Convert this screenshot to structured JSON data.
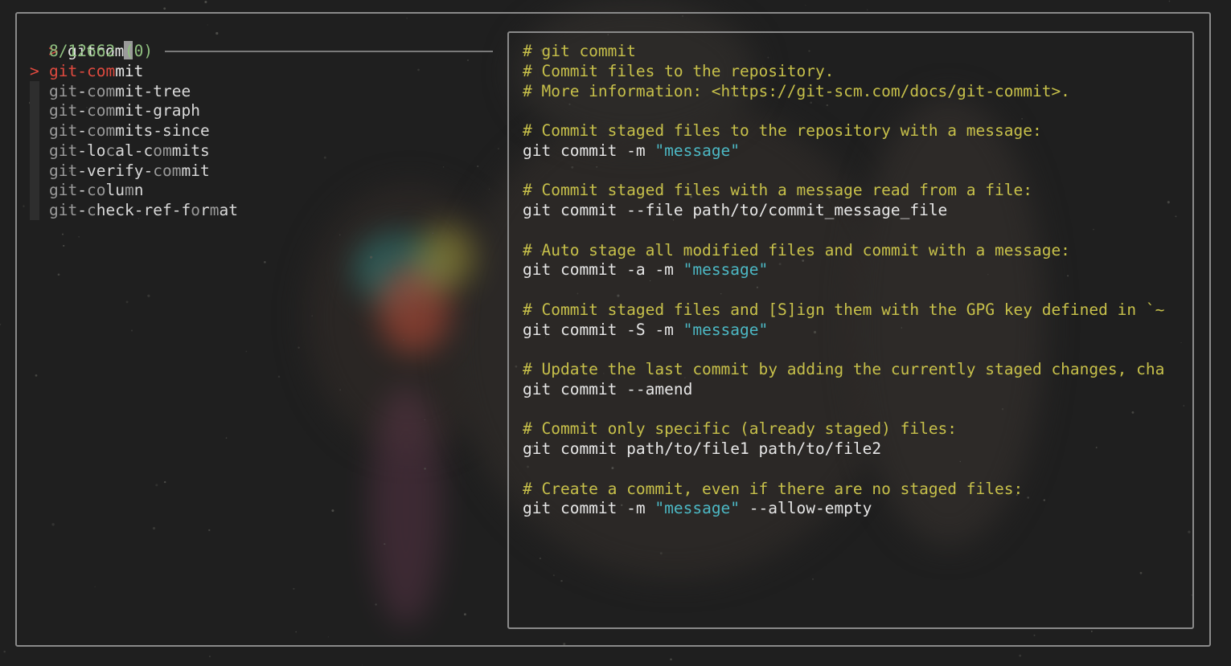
{
  "search": {
    "prompt": ">",
    "query": "gitcom",
    "match_count": "8/12662 (0)"
  },
  "results": [
    {
      "label": "git-commit",
      "selected": true,
      "prefix": "git-com",
      "rest": "mit"
    },
    {
      "label": "git-commit-tree"
    },
    {
      "label": "git-commit-graph"
    },
    {
      "label": "git-commits-since"
    },
    {
      "label": "git-local-commits"
    },
    {
      "label": "git-verify-commit"
    },
    {
      "label": "git-column"
    },
    {
      "label": "git-check-ref-format"
    }
  ],
  "preview": {
    "lines": [
      {
        "type": "comment",
        "text": "# git commit"
      },
      {
        "type": "comment",
        "text": "# Commit files to the repository."
      },
      {
        "type": "comment",
        "text": "# More information: <https://git-scm.com/docs/git-commit>."
      },
      {
        "type": "blank",
        "text": ""
      },
      {
        "type": "comment",
        "text": "# Commit staged files to the repository with a message:"
      },
      {
        "type": "code",
        "text": "git commit -m ",
        "str": "\"message\""
      },
      {
        "type": "blank",
        "text": ""
      },
      {
        "type": "comment",
        "text": "# Commit staged files with a message read from a file:"
      },
      {
        "type": "code",
        "text": "git commit --file path/to/commit_message_file"
      },
      {
        "type": "blank",
        "text": ""
      },
      {
        "type": "comment",
        "text": "# Auto stage all modified files and commit with a message:"
      },
      {
        "type": "code",
        "text": "git commit -a -m ",
        "str": "\"message\""
      },
      {
        "type": "blank",
        "text": ""
      },
      {
        "type": "comment",
        "text": "# Commit staged files and [S]ign them with the GPG key defined in `~"
      },
      {
        "type": "code",
        "text": "git commit -S -m ",
        "str": "\"message\""
      },
      {
        "type": "blank",
        "text": ""
      },
      {
        "type": "comment",
        "text": "# Update the last commit by adding the currently staged changes, cha"
      },
      {
        "type": "code",
        "text": "git commit --amend"
      },
      {
        "type": "blank",
        "text": ""
      },
      {
        "type": "comment",
        "text": "# Commit only specific (already staged) files:"
      },
      {
        "type": "code",
        "text": "git commit path/to/file1 path/to/file2"
      },
      {
        "type": "blank",
        "text": ""
      },
      {
        "type": "comment",
        "text": "# Create a commit, even if there are no staged files:"
      },
      {
        "type": "code",
        "text": "git commit -m ",
        "str": "\"message\"",
        "after": " --allow-empty"
      }
    ]
  },
  "colors": {
    "background": "#1f1f1f",
    "accent_red": "#e04a3f",
    "comment_yellow": "#c7c04a",
    "string_cyan": "#4cb8c4",
    "count_green": "#8fbf7f",
    "border": "#8a8a8a"
  }
}
